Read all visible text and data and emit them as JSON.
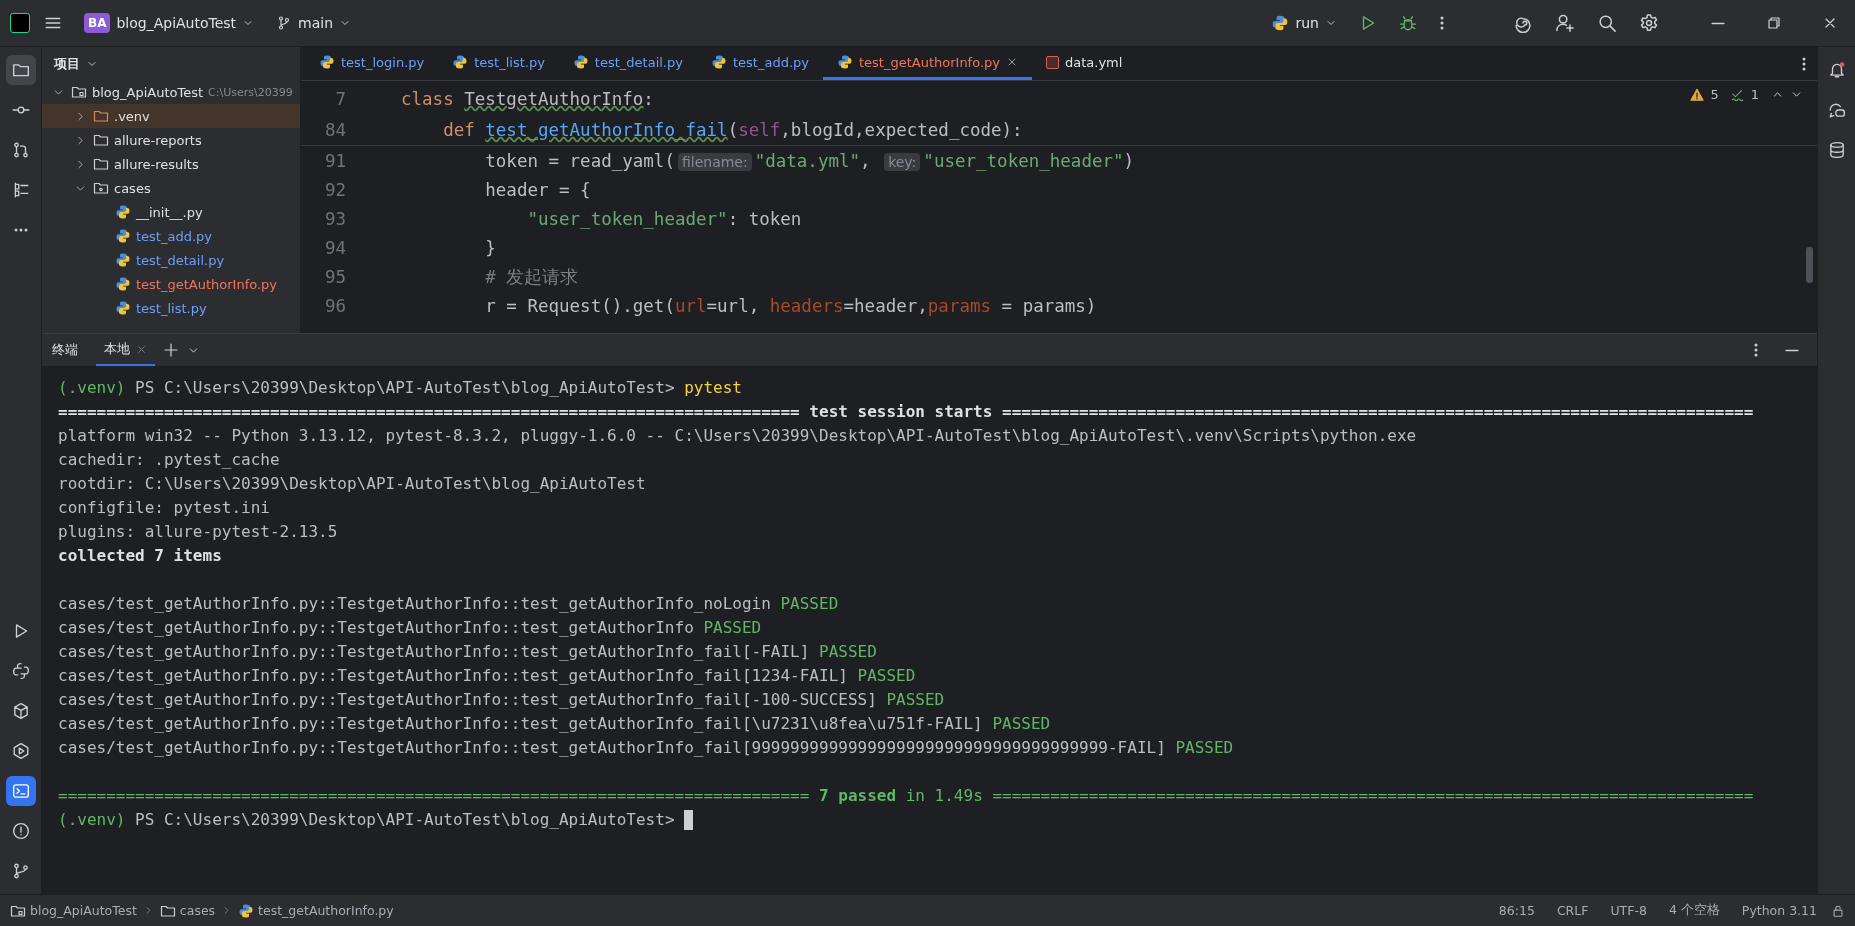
{
  "title_bar": {
    "project_badge": "BA",
    "project": "blog_ApiAutoTest",
    "branch": "main",
    "run_config": "run"
  },
  "sidebar": {
    "title": "项目",
    "tree": [
      {
        "name": "blog_ApiAutoTest",
        "hint": "C:\\Users\\20399",
        "kind": "module",
        "expanded": true,
        "selected": false,
        "color": "#dfe1e5",
        "children": [
          {
            "name": ".venv",
            "kind": "excluded",
            "expanded": false,
            "selected": true,
            "color": "#dfe1e5"
          },
          {
            "name": "allure-reports",
            "kind": "folder",
            "expanded": false,
            "selected": false,
            "color": "#dfe1e5"
          },
          {
            "name": "allure-results",
            "kind": "folder",
            "expanded": false,
            "selected": false,
            "color": "#dfe1e5"
          },
          {
            "name": "cases",
            "kind": "package",
            "expanded": true,
            "selected": false,
            "color": "#dfe1e5",
            "children": [
              {
                "name": "__init__.py",
                "kind": "file",
                "selected": false,
                "color": "#dfe1e5"
              },
              {
                "name": "test_add.py",
                "kind": "file",
                "selected": false,
                "color": "#6f9ef8"
              },
              {
                "name": "test_detail.py",
                "kind": "file",
                "selected": false,
                "color": "#6f9ef8"
              },
              {
                "name": "test_getAuthorInfo.py",
                "kind": "file",
                "selected": false,
                "color": "#f2735f"
              },
              {
                "name": "test_list.py",
                "kind": "file",
                "selected": false,
                "color": "#6f9ef8"
              }
            ]
          }
        ]
      }
    ]
  },
  "editor": {
    "tabs": [
      {
        "label": "test_login.py",
        "kind": "python",
        "selected": false,
        "color": "#6f9ef8"
      },
      {
        "label": "test_list.py",
        "kind": "python",
        "selected": false,
        "color": "#6f9ef8"
      },
      {
        "label": "test_detail.py",
        "kind": "python",
        "selected": false,
        "color": "#6f9ef8"
      },
      {
        "label": "test_add.py",
        "kind": "python",
        "selected": false,
        "color": "#6f9ef8"
      },
      {
        "label": "test_getAuthorInfo.py",
        "kind": "python",
        "selected": true,
        "color": "#f2735f"
      },
      {
        "label": "data.yml",
        "kind": "yaml",
        "selected": false,
        "color": "#dfe1e5"
      }
    ],
    "inspections": {
      "warnings": "5",
      "weak_warnings": "1"
    },
    "sticky_lines": [
      {
        "number": "7",
        "tokens": [
          {
            "kind": "keyword",
            "text": "class "
          },
          {
            "kind": "class",
            "text": "TestgetAuthorInfo"
          },
          {
            "kind": "plain",
            "text": ":"
          }
        ]
      },
      {
        "number": "84",
        "tokens": [
          {
            "kind": "keyword",
            "text": "    def "
          },
          {
            "kind": "func",
            "text": "test_getAuthorInfo_fail"
          },
          {
            "kind": "plain",
            "text": "("
          },
          {
            "kind": "self",
            "text": "self"
          },
          {
            "kind": "plain",
            "text": ",blogId,expected_code):"
          }
        ]
      }
    ],
    "lines": [
      {
        "number": "91",
        "tokens": [
          {
            "kind": "plain",
            "text": "        token = read_yaml("
          },
          {
            "kind": "hint",
            "text": "filename:"
          },
          {
            "kind": "string",
            "text": "\"data.yml\""
          },
          {
            "kind": "plain",
            "text": ", "
          },
          {
            "kind": "hint",
            "text": "key:"
          },
          {
            "kind": "string",
            "text": "\"user_token_header\""
          },
          {
            "kind": "plain",
            "text": ")"
          }
        ]
      },
      {
        "number": "92",
        "tokens": [
          {
            "kind": "plain",
            "text": "        header = {"
          }
        ]
      },
      {
        "number": "93",
        "tokens": [
          {
            "kind": "string",
            "text": "            \"user_token_header\""
          },
          {
            "kind": "plain",
            "text": ": token"
          }
        ]
      },
      {
        "number": "94",
        "tokens": [
          {
            "kind": "plain",
            "text": "        }"
          }
        ]
      },
      {
        "number": "95",
        "tokens": [
          {
            "kind": "comment",
            "text": "        # 发起请求"
          }
        ]
      },
      {
        "number": "96",
        "tokens": [
          {
            "kind": "plain",
            "text": "        r = Request().get("
          },
          {
            "kind": "kwarg",
            "text": "url"
          },
          {
            "kind": "plain",
            "text": "=url, "
          },
          {
            "kind": "kwarg",
            "text": "headers"
          },
          {
            "kind": "plain",
            "text": "=header,"
          },
          {
            "kind": "kwarg",
            "text": "params"
          },
          {
            "kind": "plain",
            "text": " = params)"
          }
        ]
      }
    ]
  },
  "terminal": {
    "title": "终端",
    "tabs": [
      {
        "label": "本地",
        "selected": true
      }
    ],
    "blocks": [
      {
        "lines": [
          [
            {
              "kind": "venv",
              "text": "(.venv)"
            },
            {
              "kind": "plain",
              "text": " PS C:\\Users\\20399\\Desktop\\API-AutoTest\\blog_ApiAutoTest> "
            },
            {
              "kind": "command",
              "text": "pytest"
            }
          ],
          [
            {
              "kind": "bold",
              "text": "============================================================================= test session starts =============================================================================="
            }
          ],
          [
            {
              "kind": "plain",
              "text": "platform win32 -- Python 3.13.12, pytest-8.3.2, pluggy-1.6.0 -- C:\\Users\\20399\\Desktop\\API-AutoTest\\blog_ApiAutoTest\\.venv\\Scripts\\python.exe"
            }
          ],
          [
            {
              "kind": "plain",
              "text": "cachedir: .pytest_cache"
            }
          ],
          [
            {
              "kind": "plain",
              "text": "rootdir: C:\\Users\\20399\\Desktop\\API-AutoTest\\blog_ApiAutoTest"
            }
          ],
          [
            {
              "kind": "plain",
              "text": "configfile: pytest.ini"
            }
          ],
          [
            {
              "kind": "plain",
              "text": "plugins: allure-pytest-2.13.5"
            }
          ],
          [
            {
              "kind": "bold",
              "text": "collected 7 items"
            }
          ]
        ]
      },
      {
        "lines": [
          [
            {
              "kind": "plain",
              "text": "cases/test_getAuthorInfo.py::TestgetAuthorInfo::test_getAuthorInfo_noLogin "
            },
            {
              "kind": "passed",
              "text": "PASSED"
            }
          ],
          [
            {
              "kind": "plain",
              "text": "cases/test_getAuthorInfo.py::TestgetAuthorInfo::test_getAuthorInfo "
            },
            {
              "kind": "passed",
              "text": "PASSED"
            }
          ],
          [
            {
              "kind": "plain",
              "text": "cases/test_getAuthorInfo.py::TestgetAuthorInfo::test_getAuthorInfo_fail[-FAIL] "
            },
            {
              "kind": "passed",
              "text": "PASSED"
            }
          ],
          [
            {
              "kind": "plain",
              "text": "cases/test_getAuthorInfo.py::TestgetAuthorInfo::test_getAuthorInfo_fail[1234-FAIL] "
            },
            {
              "kind": "passed",
              "text": "PASSED"
            }
          ],
          [
            {
              "kind": "plain",
              "text": "cases/test_getAuthorInfo.py::TestgetAuthorInfo::test_getAuthorInfo_fail[-100-SUCCESS] "
            },
            {
              "kind": "passed",
              "text": "PASSED"
            }
          ],
          [
            {
              "kind": "plain",
              "text": "cases/test_getAuthorInfo.py::TestgetAuthorInfo::test_getAuthorInfo_fail[\\u7231\\u8fea\\u751f-FAIL] "
            },
            {
              "kind": "passed",
              "text": "PASSED"
            }
          ],
          [
            {
              "kind": "plain",
              "text": "cases/test_getAuthorInfo.py::TestgetAuthorInfo::test_getAuthorInfo_fail[9999999999999999999999999999999999999-FAIL] "
            },
            {
              "kind": "passed",
              "text": "PASSED"
            }
          ]
        ]
      },
      {
        "lines": [
          [
            {
              "kind": "summary",
              "text": "============================================================================== "
            },
            {
              "kind": "summary_bold",
              "text": "7 passed"
            },
            {
              "kind": "summary",
              "text": " in 1.49s ==============================================================================="
            }
          ],
          [
            {
              "kind": "venv",
              "text": "(.venv)"
            },
            {
              "kind": "plain",
              "text": " PS C:\\Users\\20399\\Desktop\\API-AutoTest\\blog_ApiAutoTest> "
            }
          ]
        ]
      }
    ]
  },
  "status_bar": {
    "breadcrumbs": [
      {
        "label": "blog_ApiAutoTest",
        "kind": "module"
      },
      {
        "label": "cases",
        "kind": "folder"
      },
      {
        "label": "test_getAuthorInfo.py",
        "kind": "python"
      }
    ],
    "items": [
      "86:15",
      "CRLF",
      "UTF-8",
      "4 个空格",
      "Python 3.11"
    ]
  }
}
